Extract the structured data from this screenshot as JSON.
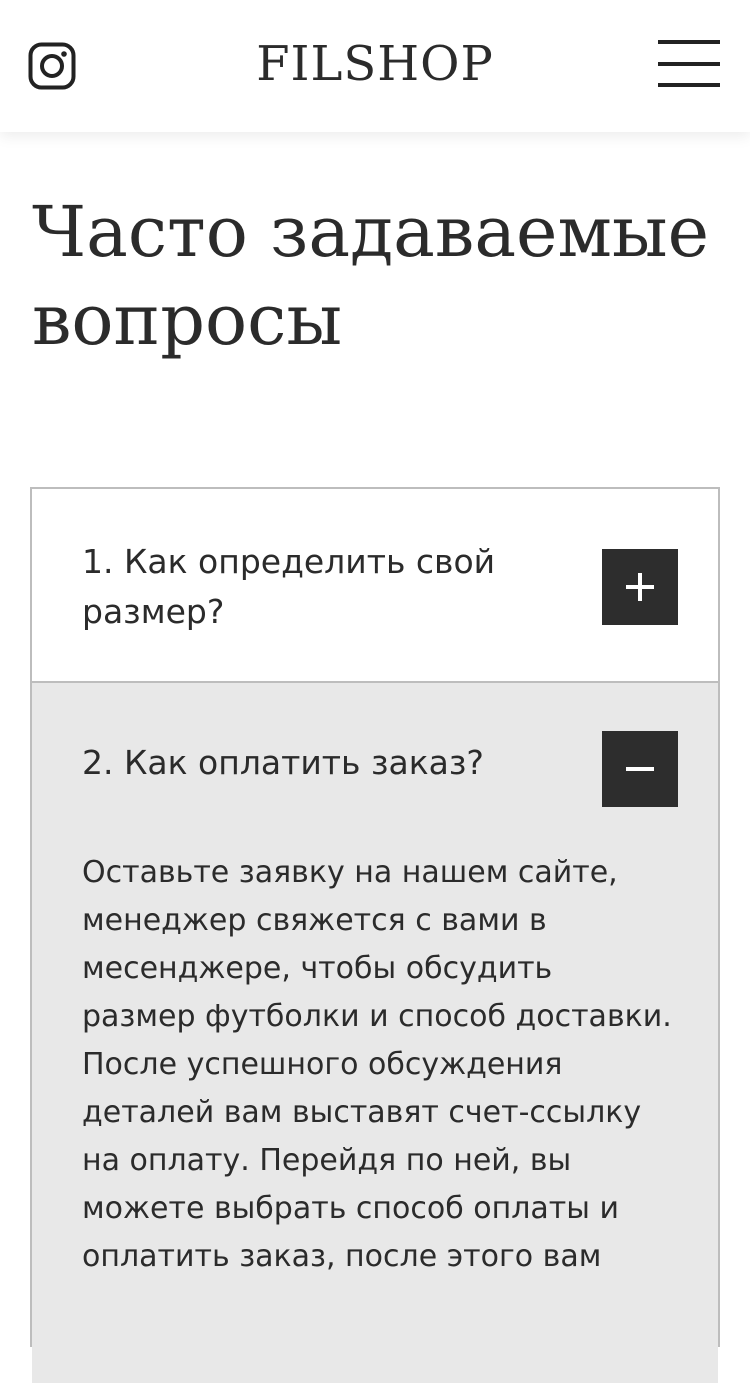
{
  "header": {
    "brand": "FILSHOP",
    "instagram_icon": "instagram-icon",
    "menu_icon": "hamburger-menu-icon"
  },
  "page": {
    "title": "Часто задаваемые вопросы"
  },
  "faq": {
    "items": [
      {
        "question": "1. Как определить свой размер?",
        "expanded": false,
        "toggle_icon": "plus-icon"
      },
      {
        "question": "2. Как оплатить заказ?",
        "expanded": true,
        "toggle_icon": "minus-icon",
        "answer": "Оставьте заявку на нашем сайте, менеджер свяжется с вами в месенджере, чтобы обсудить размер футболки и способ доставки. После успешного обсуждения деталей вам выставят счет-ссылку на оплату. Перейдя по ней, вы можете выбрать способ оплаты и оплатить заказ, после этого вам"
      }
    ]
  },
  "colors": {
    "text": "#2b2b2b",
    "toggle_bg": "#2d2d2d",
    "expanded_bg": "#e8e8e8",
    "border": "#bdbdbd"
  }
}
